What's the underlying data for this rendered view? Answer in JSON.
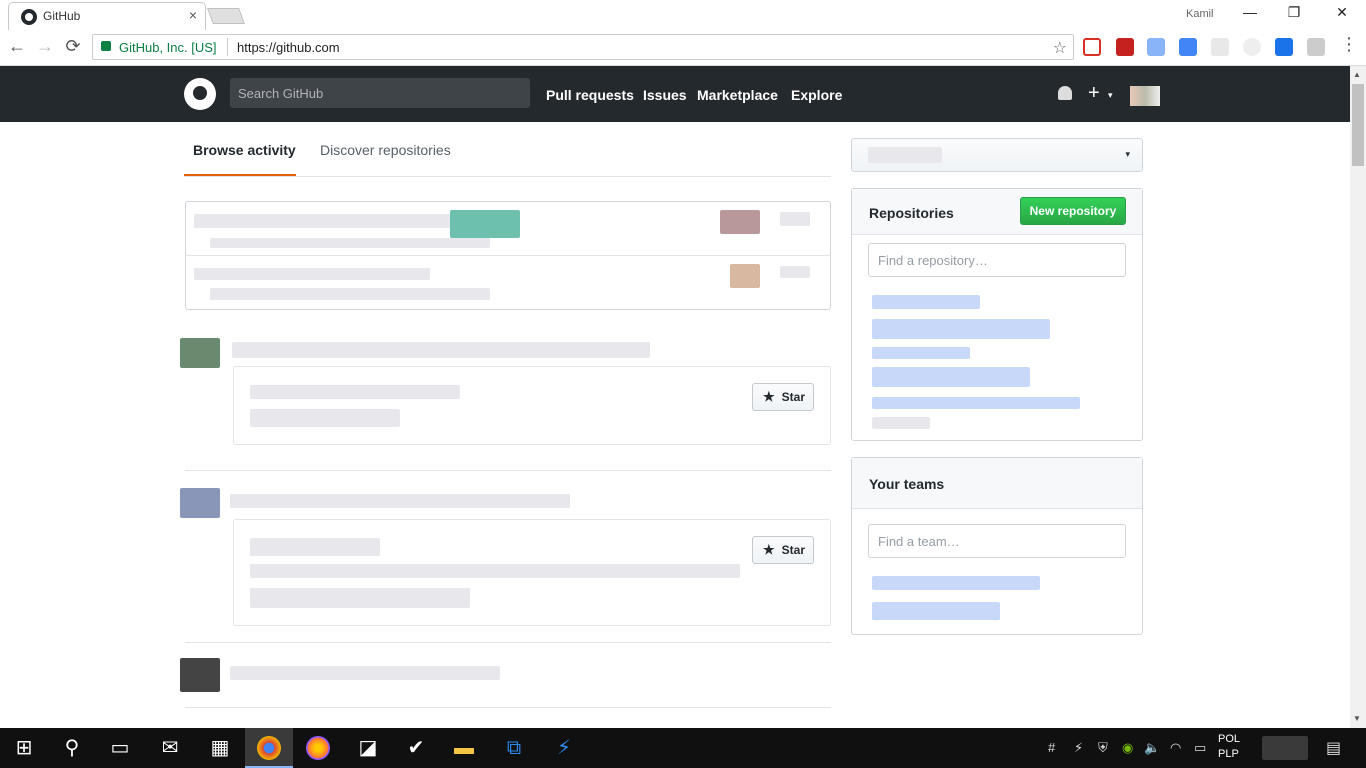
{
  "browser": {
    "tab_title": "GitHub",
    "tab_close": "×",
    "window_user": "Kamil",
    "min": "—",
    "restore": "❐",
    "close": "✕",
    "back": "←",
    "forward": "→",
    "reload": "⟳",
    "ev_label": "GitHub, Inc. [US]",
    "url": "https://github.com",
    "star": "☆"
  },
  "header": {
    "search_placeholder": "Search GitHub",
    "nav": [
      "Pull requests",
      "Issues",
      "Marketplace",
      "Explore"
    ],
    "plus": "+",
    "dropdown": "▾"
  },
  "tabs": {
    "browse": "Browse activity",
    "discover": "Discover repositories"
  },
  "feed": {
    "star_label": "Star",
    "star_icon": "★"
  },
  "sidebar": {
    "repositories_title": "Repositories",
    "new_repo": "New repository",
    "find_repo_placeholder": "Find a repository…",
    "teams_title": "Your teams",
    "find_team_placeholder": "Find a team…",
    "caret": "▾"
  },
  "taskbar": {
    "lang_top": "POL",
    "lang_bottom": "PLP"
  },
  "colors": {
    "header_bg": "#24292e",
    "accent_orange": "#e36209",
    "new_repo_green": "#28a745"
  }
}
